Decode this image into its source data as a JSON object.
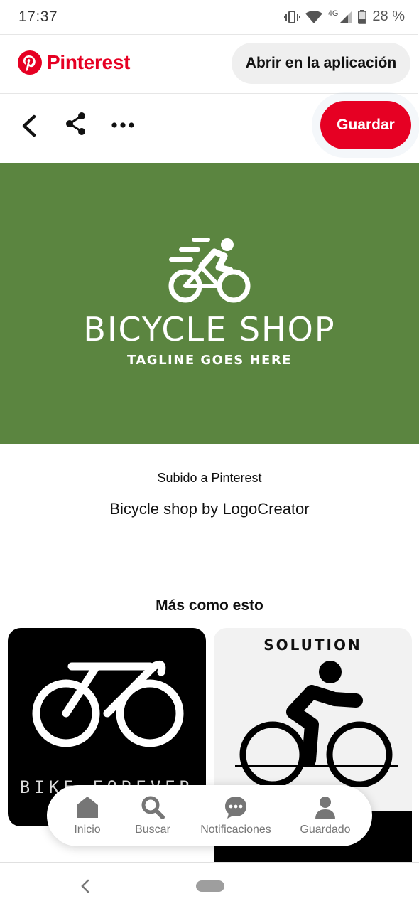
{
  "status_bar": {
    "time": "17:37",
    "network": "4G",
    "battery_percent": "28 %"
  },
  "header": {
    "brand": "Pinterest",
    "open_app_label": "Abrir en la aplicación",
    "brand_color": "#e60023"
  },
  "actions": {
    "back_icon": "chevron-left-icon",
    "share_icon": "share-icon",
    "more_icon": "more-horizontal-icon",
    "save_label": "Guardar"
  },
  "pin": {
    "image_title": "BICYCLE SHOP",
    "image_tagline": "TAGLINE GOES HERE",
    "image_bg": "#5b8540",
    "uploaded_text": "Subido a Pinterest",
    "description": "Bicycle shop by LogoCreator"
  },
  "more_like_this": {
    "heading": "Más como esto",
    "cards": [
      {
        "text": "BIKE FOREVER"
      },
      {
        "text": "SOLUTION"
      }
    ]
  },
  "bottom_nav": {
    "items": [
      {
        "label": "Inicio",
        "icon": "home-icon"
      },
      {
        "label": "Buscar",
        "icon": "search-icon"
      },
      {
        "label": "Notificaciones",
        "icon": "chat-icon"
      },
      {
        "label": "Guardado",
        "icon": "profile-icon"
      }
    ]
  }
}
